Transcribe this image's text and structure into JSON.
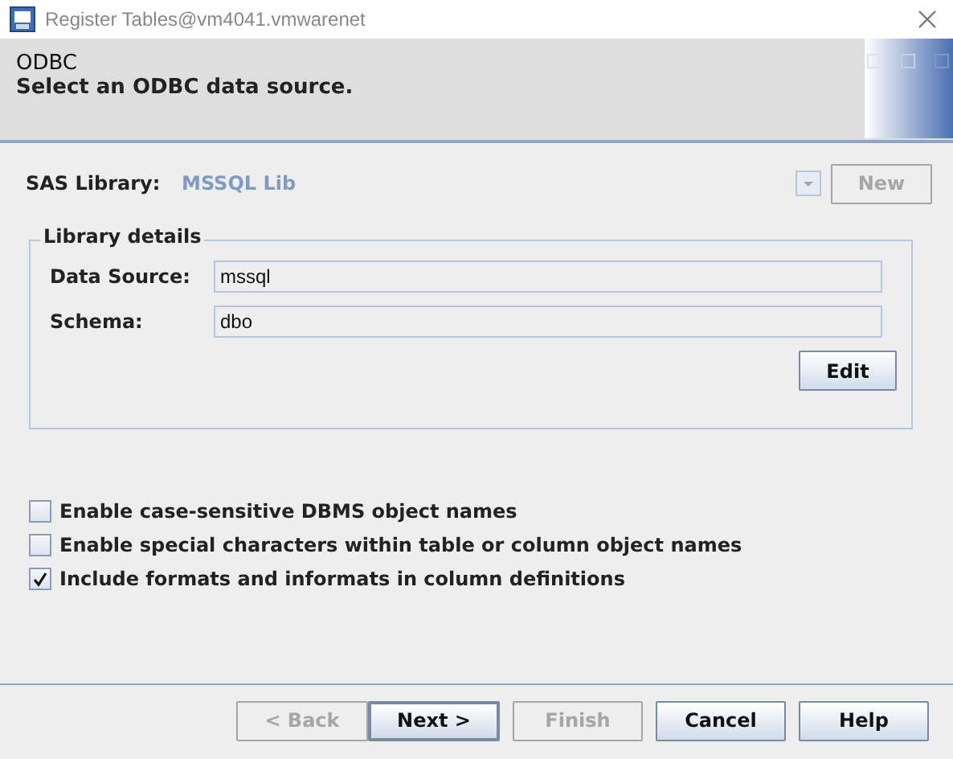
{
  "window": {
    "title": "Register Tables@vm4041.vmwarenet"
  },
  "header": {
    "title": "ODBC",
    "subtitle": "Select an ODBC data source."
  },
  "sas_library": {
    "label": "SAS Library:",
    "value": "MSSQL Lib",
    "disabled": true,
    "new_button": {
      "label": "New",
      "disabled": true
    }
  },
  "library_details": {
    "legend": "Library details",
    "fields": [
      {
        "label": "Data Source:",
        "value": "mssql"
      },
      {
        "label": "Schema:",
        "value": "dbo"
      }
    ],
    "edit_button": "Edit"
  },
  "options": [
    {
      "label": "Enable case-sensitive DBMS object names",
      "checked": false
    },
    {
      "label": "Enable special characters within table or column object names",
      "checked": false
    },
    {
      "label": "Include formats and informats in column definitions",
      "checked": true
    }
  ],
  "buttons": [
    {
      "label": "< Back",
      "disabled": true,
      "default": false
    },
    {
      "label": "Next >",
      "disabled": false,
      "default": true
    },
    {
      "label": "Finish",
      "disabled": true,
      "default": false
    },
    {
      "label": "Cancel",
      "disabled": false,
      "default": false
    },
    {
      "label": "Help",
      "disabled": false,
      "default": false
    }
  ]
}
